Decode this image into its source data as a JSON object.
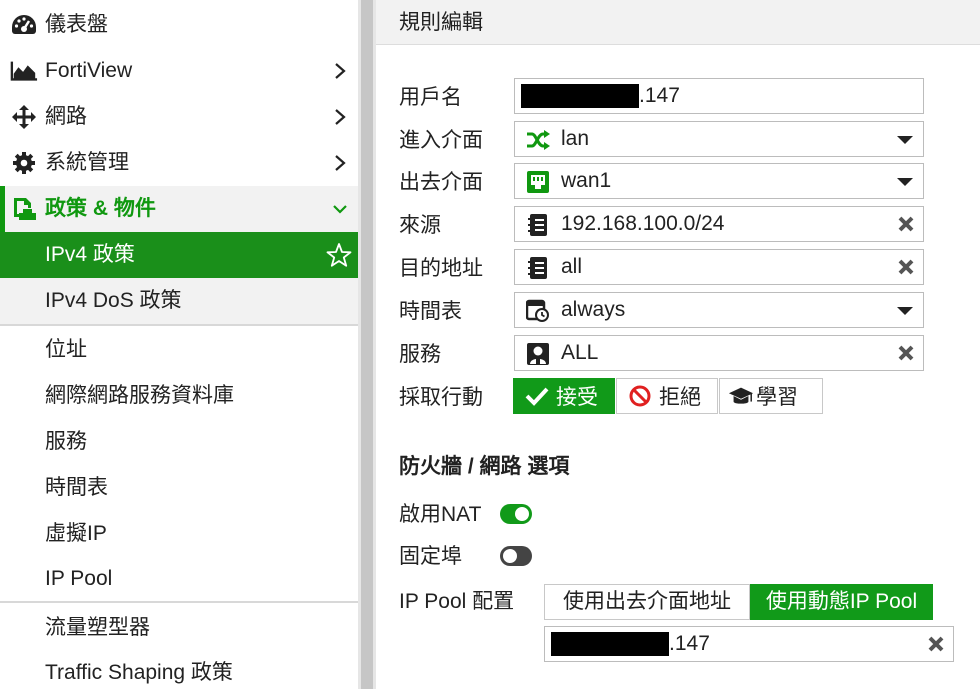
{
  "sidebar": {
    "items": [
      {
        "label": "儀表盤",
        "icon": "dashboard-icon"
      },
      {
        "label": "FortiView",
        "icon": "area-chart-icon"
      },
      {
        "label": "網路",
        "icon": "move-arrows-icon"
      },
      {
        "label": "系統管理",
        "icon": "gear-icon"
      },
      {
        "label": "政策 & 物件",
        "icon": "policy-stamp-icon"
      },
      {
        "label": "IPv4 政策"
      },
      {
        "label": "IPv4 DoS 政策"
      },
      {
        "label": "位址"
      },
      {
        "label": "網際網路服務資料庫"
      },
      {
        "label": "服務"
      },
      {
        "label": "時間表"
      },
      {
        "label": "虛擬IP"
      },
      {
        "label": "IP Pool"
      },
      {
        "label": "流量塑型器"
      },
      {
        "label": "Traffic Shaping 政策"
      }
    ]
  },
  "header": {
    "title": "規則編輯"
  },
  "form": {
    "name": {
      "label": "用戶名",
      "value": ".147"
    },
    "incoming": {
      "label": "進入介面",
      "value": "lan",
      "icon": "shuffle-icon"
    },
    "outgoing": {
      "label": "出去介面",
      "value": "wan1",
      "icon": "port-icon"
    },
    "source": {
      "label": "來源",
      "value": "192.168.100.0/24",
      "icon": "address-book-icon"
    },
    "destination": {
      "label": "目的地址",
      "value": "all",
      "icon": "address-book-icon"
    },
    "schedule": {
      "label": "時間表",
      "value": "always",
      "icon": "schedule-icon"
    },
    "service": {
      "label": "服務",
      "value": "ALL",
      "icon": "service-user-icon"
    },
    "action": {
      "label": "採取行動",
      "accept": "接受",
      "deny": "拒絕",
      "learn": "學習",
      "selected": "accept"
    }
  },
  "firewall": {
    "section_title": "防火牆 / 網路 選項",
    "nat": {
      "label": "啟用NAT",
      "enabled": true
    },
    "fixed_port": {
      "label": "固定埠",
      "enabled": false
    },
    "ippool": {
      "label": "IP Pool 配置",
      "option_outgoing": "使用出去介面地址",
      "option_dynamic": "使用動態IP Pool",
      "selected": "dynamic",
      "value": ".147"
    }
  },
  "colors": {
    "accent": "#119a19",
    "active_text": "#109810"
  }
}
